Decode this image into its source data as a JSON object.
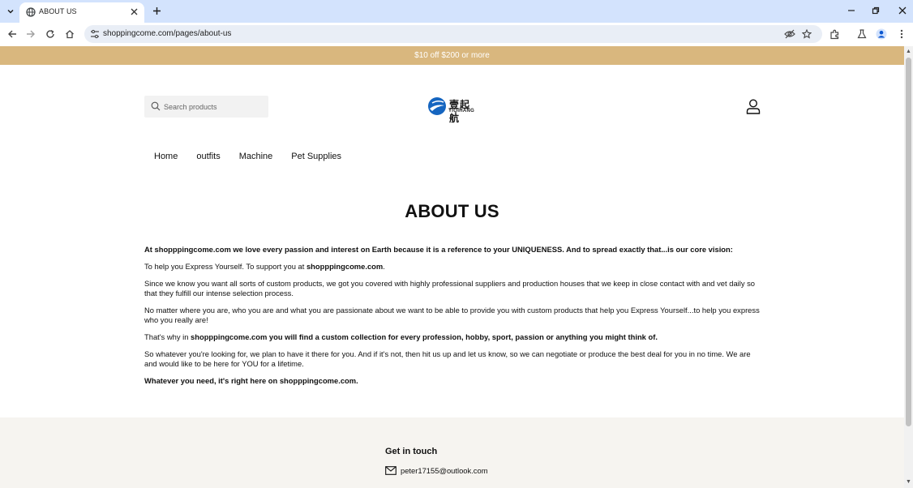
{
  "browser": {
    "tab_title": "ABOUT US",
    "url": "shoppingcome.com/pages/about-us"
  },
  "announcement": "$10 off $200 or more",
  "header": {
    "search_placeholder": "Search products",
    "logo_cn": "壹起航",
    "logo_en": "YIQIHANG"
  },
  "nav": {
    "items": [
      "Home",
      "outfits",
      "Machine",
      "Pet Supplies"
    ]
  },
  "page": {
    "title": "ABOUT US",
    "p1": "At shopppingcome.com we love every passion and interest on Earth because it is a reference to your UNIQUENESS. And to spread exactly that...is our core vision:",
    "p2_a": "To help you Express Yourself. To support you at ",
    "p2_b": "shopppingcome.com",
    "p2_c": ".",
    "p3": "Since we know you want all sorts of custom products, we got you covered with highly professional suppliers and production houses that we keep in close contact with and vet daily so that they fulfill our intense selection process.",
    "p4": "No matter where you are, who you are and what you are passionate about we want to be able to provide you with custom products that help you Express Yourself...to help you express who you really are!",
    "p5_a": "That's why in ",
    "p5_b": "shopppingcome.com you will find a custom collection for every profession, hobby, sport, passion or anything you might think of.",
    "p6": "So whatever you're looking for, we plan to have it there for you. And if it's not, then hit us up and let us know, so we can negotiate or produce the best deal for you in no time. We are and would like to be here for YOU for a lifetime.",
    "p7": "Whatever you need, it's right here on shopppingcome.com."
  },
  "footer": {
    "title": "Get in touch",
    "email": "peter17155@outlook.com"
  },
  "colors": {
    "announcement_bg": "#d9b77e",
    "tabstrip_bg": "#d3e3fd",
    "logo_blue": "#1565c0"
  }
}
